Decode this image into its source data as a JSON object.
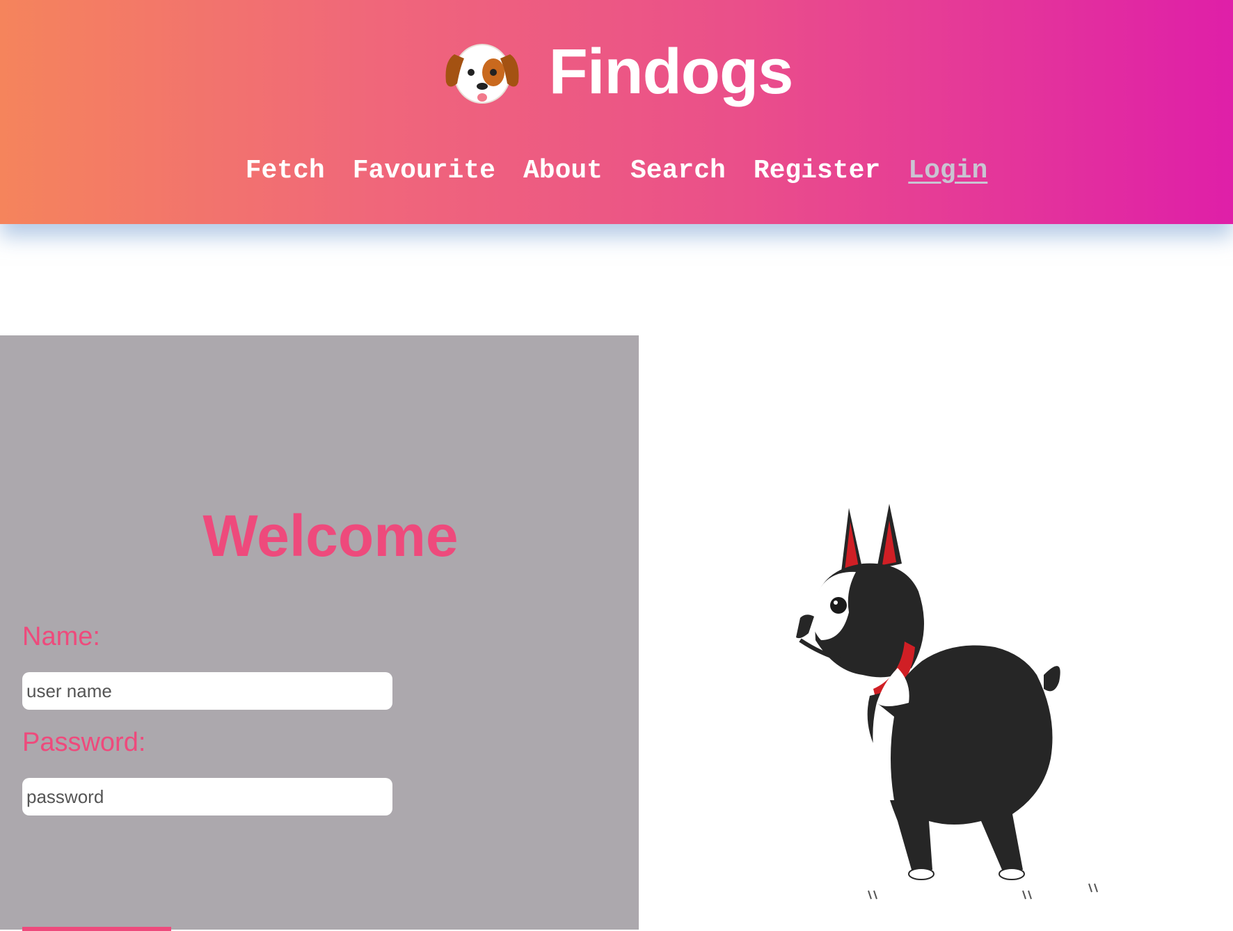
{
  "brand": {
    "title": "Findogs",
    "logo_icon": "puppy-face-icon"
  },
  "nav": {
    "items": [
      {
        "label": "Fetch"
      },
      {
        "label": "Favourite"
      },
      {
        "label": "About"
      },
      {
        "label": "Search"
      },
      {
        "label": "Register"
      },
      {
        "label": "Login",
        "active": true
      }
    ]
  },
  "login": {
    "heading": "Welcome",
    "name_label": "Name:",
    "name_placeholder": "user name",
    "password_label": "Password:",
    "password_placeholder": "password"
  },
  "illustration": {
    "icon": "boston-terrier-illustration"
  },
  "colors": {
    "header_gradient_start": "#f5845c",
    "header_gradient_end": "#df1fa8",
    "accent_pink": "#ee4a7c",
    "panel_gray": "#aca8ad",
    "active_nav": "#c9c4d2"
  }
}
